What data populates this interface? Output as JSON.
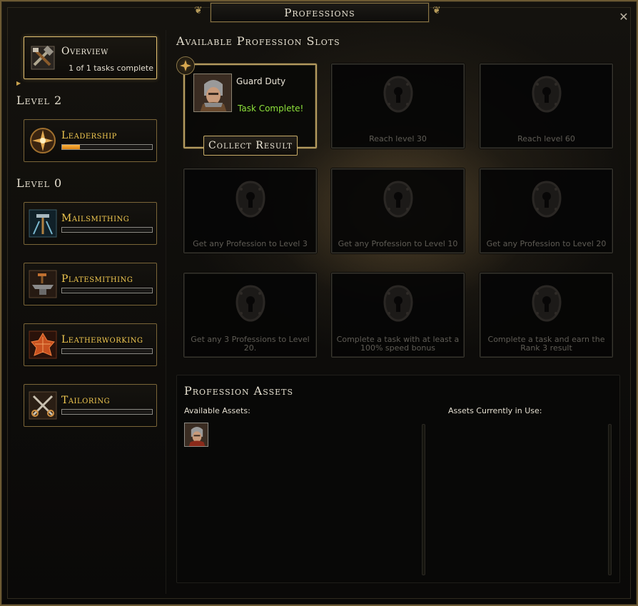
{
  "window": {
    "title": "Professions",
    "close_glyph": "✕"
  },
  "sidebar": {
    "overview": {
      "label": "Overview",
      "status": "1 of 1 tasks complete"
    },
    "groups": [
      {
        "heading": "Level 2",
        "items": [
          {
            "label": "Leadership",
            "icon": "leadership-icon",
            "progress": 0.2
          }
        ]
      },
      {
        "heading": "Level 0",
        "items": [
          {
            "label": "Mailsmithing",
            "icon": "mailsmithing-icon",
            "progress": 0
          },
          {
            "label": "Platesmithing",
            "icon": "platesmithing-icon",
            "progress": 0
          },
          {
            "label": "Leatherworking",
            "icon": "leatherworking-icon",
            "progress": 0
          },
          {
            "label": "Tailoring",
            "icon": "tailoring-icon",
            "progress": 0
          }
        ]
      }
    ]
  },
  "slots": {
    "title": "Available Profession Slots",
    "active": {
      "task": "Guard Duty",
      "status": "Task Complete!",
      "button": "Collect Result"
    },
    "locked": [
      "Reach level 30",
      "Reach level 60",
      "Get any Profession to Level 3",
      "Get any Profession to Level 10",
      "Get any Profession to Level 20",
      "Get any 3 Professions to Level 20.",
      "Complete a task with at least a 100% speed bonus",
      "Complete a task and earn the Rank 3 result"
    ]
  },
  "assets": {
    "title": "Profession Assets",
    "available_label": "Available Assets:",
    "in_use_label": "Assets Currently in Use:",
    "available_count": 1
  },
  "colors": {
    "accent_gold": "#f0c850",
    "task_complete_green": "#8ee23b",
    "progress_orange": "#ffb340"
  }
}
